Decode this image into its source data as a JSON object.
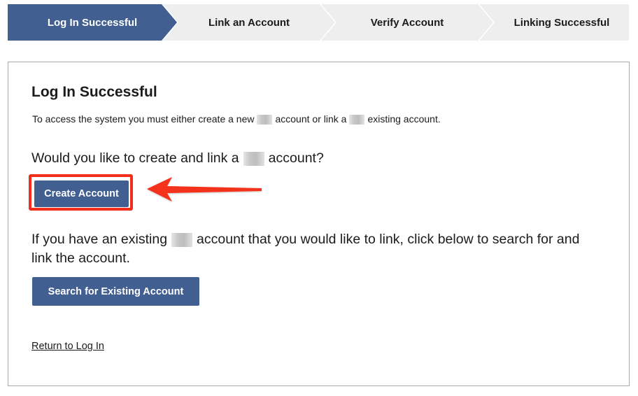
{
  "stepper": {
    "steps": [
      {
        "label": "Log In Successful",
        "state": "active"
      },
      {
        "label": "Link an Account",
        "state": "inactive"
      },
      {
        "label": "Verify Account",
        "state": "inactive"
      },
      {
        "label": "Linking Successful",
        "state": "inactive"
      }
    ],
    "colors": {
      "active": "#415f91",
      "inactive": "#eeeeee"
    }
  },
  "main": {
    "title": "Log In Successful",
    "intro": {
      "part1": "To access the system you must either create a new",
      "part2": "account or link a",
      "part3": "existing account."
    },
    "create_question": {
      "part1": "Would you like to create and link a",
      "part2": "account?"
    },
    "create_button_label": "Create Account",
    "existing_text": {
      "part1": "If you have an existing",
      "part2": "account that you would like to link, click below to search for and link the account."
    },
    "search_button_label": "Search for Existing Account",
    "return_link": "Return to Log In"
  },
  "annotation": {
    "highlight_color": "#f02e19",
    "arrow_icon": "left-arrow-icon"
  }
}
